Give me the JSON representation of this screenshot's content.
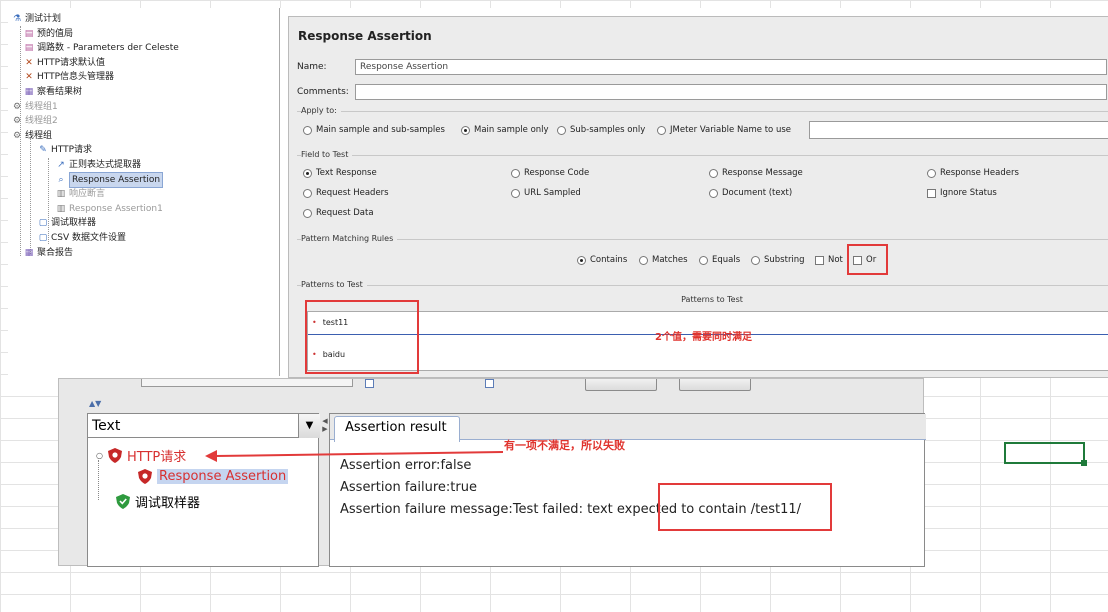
{
  "tree": {
    "nodes": [
      {
        "label": "测试计划",
        "icon": "test-plan-icon",
        "selected": false,
        "dim": false
      },
      {
        "label": "预的值局",
        "icon": "config-icon",
        "selected": false,
        "dim": false
      },
      {
        "label": "调路数 - Parameters der Celeste",
        "icon": "config-icon",
        "selected": false,
        "dim": false
      },
      {
        "label": "HTTP请求默认值",
        "icon": "tool-icon",
        "selected": false,
        "dim": false
      },
      {
        "label": "HTTP信息头管理器",
        "icon": "tool-icon",
        "selected": false,
        "dim": false
      },
      {
        "label": "察看结果树",
        "icon": "listener-icon",
        "selected": false,
        "dim": false
      },
      {
        "label": "线程组1",
        "icon": "gear-icon",
        "selected": false,
        "dim": true
      },
      {
        "label": "线程组2",
        "icon": "gear-icon",
        "selected": false,
        "dim": true
      },
      {
        "label": "线程组",
        "icon": "gear-icon",
        "selected": false,
        "dim": false
      },
      {
        "label": "HTTP请求",
        "icon": "pen-icon",
        "selected": false,
        "dim": false
      },
      {
        "label": "正则表达式提取器",
        "icon": "extractor-icon",
        "selected": false,
        "dim": false
      },
      {
        "label": "Response Assertion",
        "icon": "magnifier-icon",
        "selected": true,
        "dim": false
      },
      {
        "label": "响应断言",
        "icon": "assertion-icon",
        "selected": false,
        "dim": true
      },
      {
        "label": "Response Assertion1",
        "icon": "assertion-icon",
        "selected": false,
        "dim": true
      },
      {
        "label": "调试取样器",
        "icon": "sampler-icon",
        "selected": false,
        "dim": false
      },
      {
        "label": "CSV 数据文件设置",
        "icon": "sampler-icon",
        "selected": false,
        "dim": false
      },
      {
        "label": "聚合报告",
        "icon": "listener-icon",
        "selected": false,
        "dim": false
      }
    ]
  },
  "assertion": {
    "title": "Response Assertion",
    "name_label": "Name:",
    "name_value": "Response Assertion",
    "comments_label": "Comments:",
    "comments_value": "",
    "apply_to": {
      "title": "Apply to:",
      "options": [
        "Main sample and sub-samples",
        "Main sample only",
        "Sub-samples only",
        "JMeter Variable Name to use"
      ],
      "selected": "Main sample only",
      "variable_value": ""
    },
    "field_to_test": {
      "title": "Field to Test",
      "options": [
        "Text Response",
        "Response Code",
        "Response Message",
        "Response Headers",
        "Request Headers",
        "URL Sampled",
        "Document (text)",
        "Ignore Status",
        "Request Data"
      ],
      "selected": "Text Response"
    },
    "pattern_matching": {
      "title": "Pattern Matching Rules",
      "options": [
        "Contains",
        "Matches",
        "Equals",
        "Substring",
        "Not",
        "Or"
      ],
      "selected": "Contains"
    },
    "patterns": {
      "title": "Patterns to Test",
      "header": "Patterns to Test",
      "items": [
        "test11",
        "baidu"
      ]
    },
    "note": "2个值，需要同时满足"
  },
  "results": {
    "combo_value": "Text",
    "tree_items": [
      {
        "label": "HTTP请求",
        "status": "fail"
      },
      {
        "label": "Response Assertion",
        "status": "fail"
      },
      {
        "label": "调试取样器",
        "status": "ok"
      }
    ],
    "tab_label": "Assertion result",
    "lines": [
      "Assertion error:false",
      "Assertion failure:true",
      "Assertion failure message:Test failed: text expected to contain /test11/"
    ],
    "note": "有一项不满足，所以失败"
  },
  "colors": {
    "annotation_red": "#e23a3a",
    "selection_green": "#1f7a3a"
  }
}
